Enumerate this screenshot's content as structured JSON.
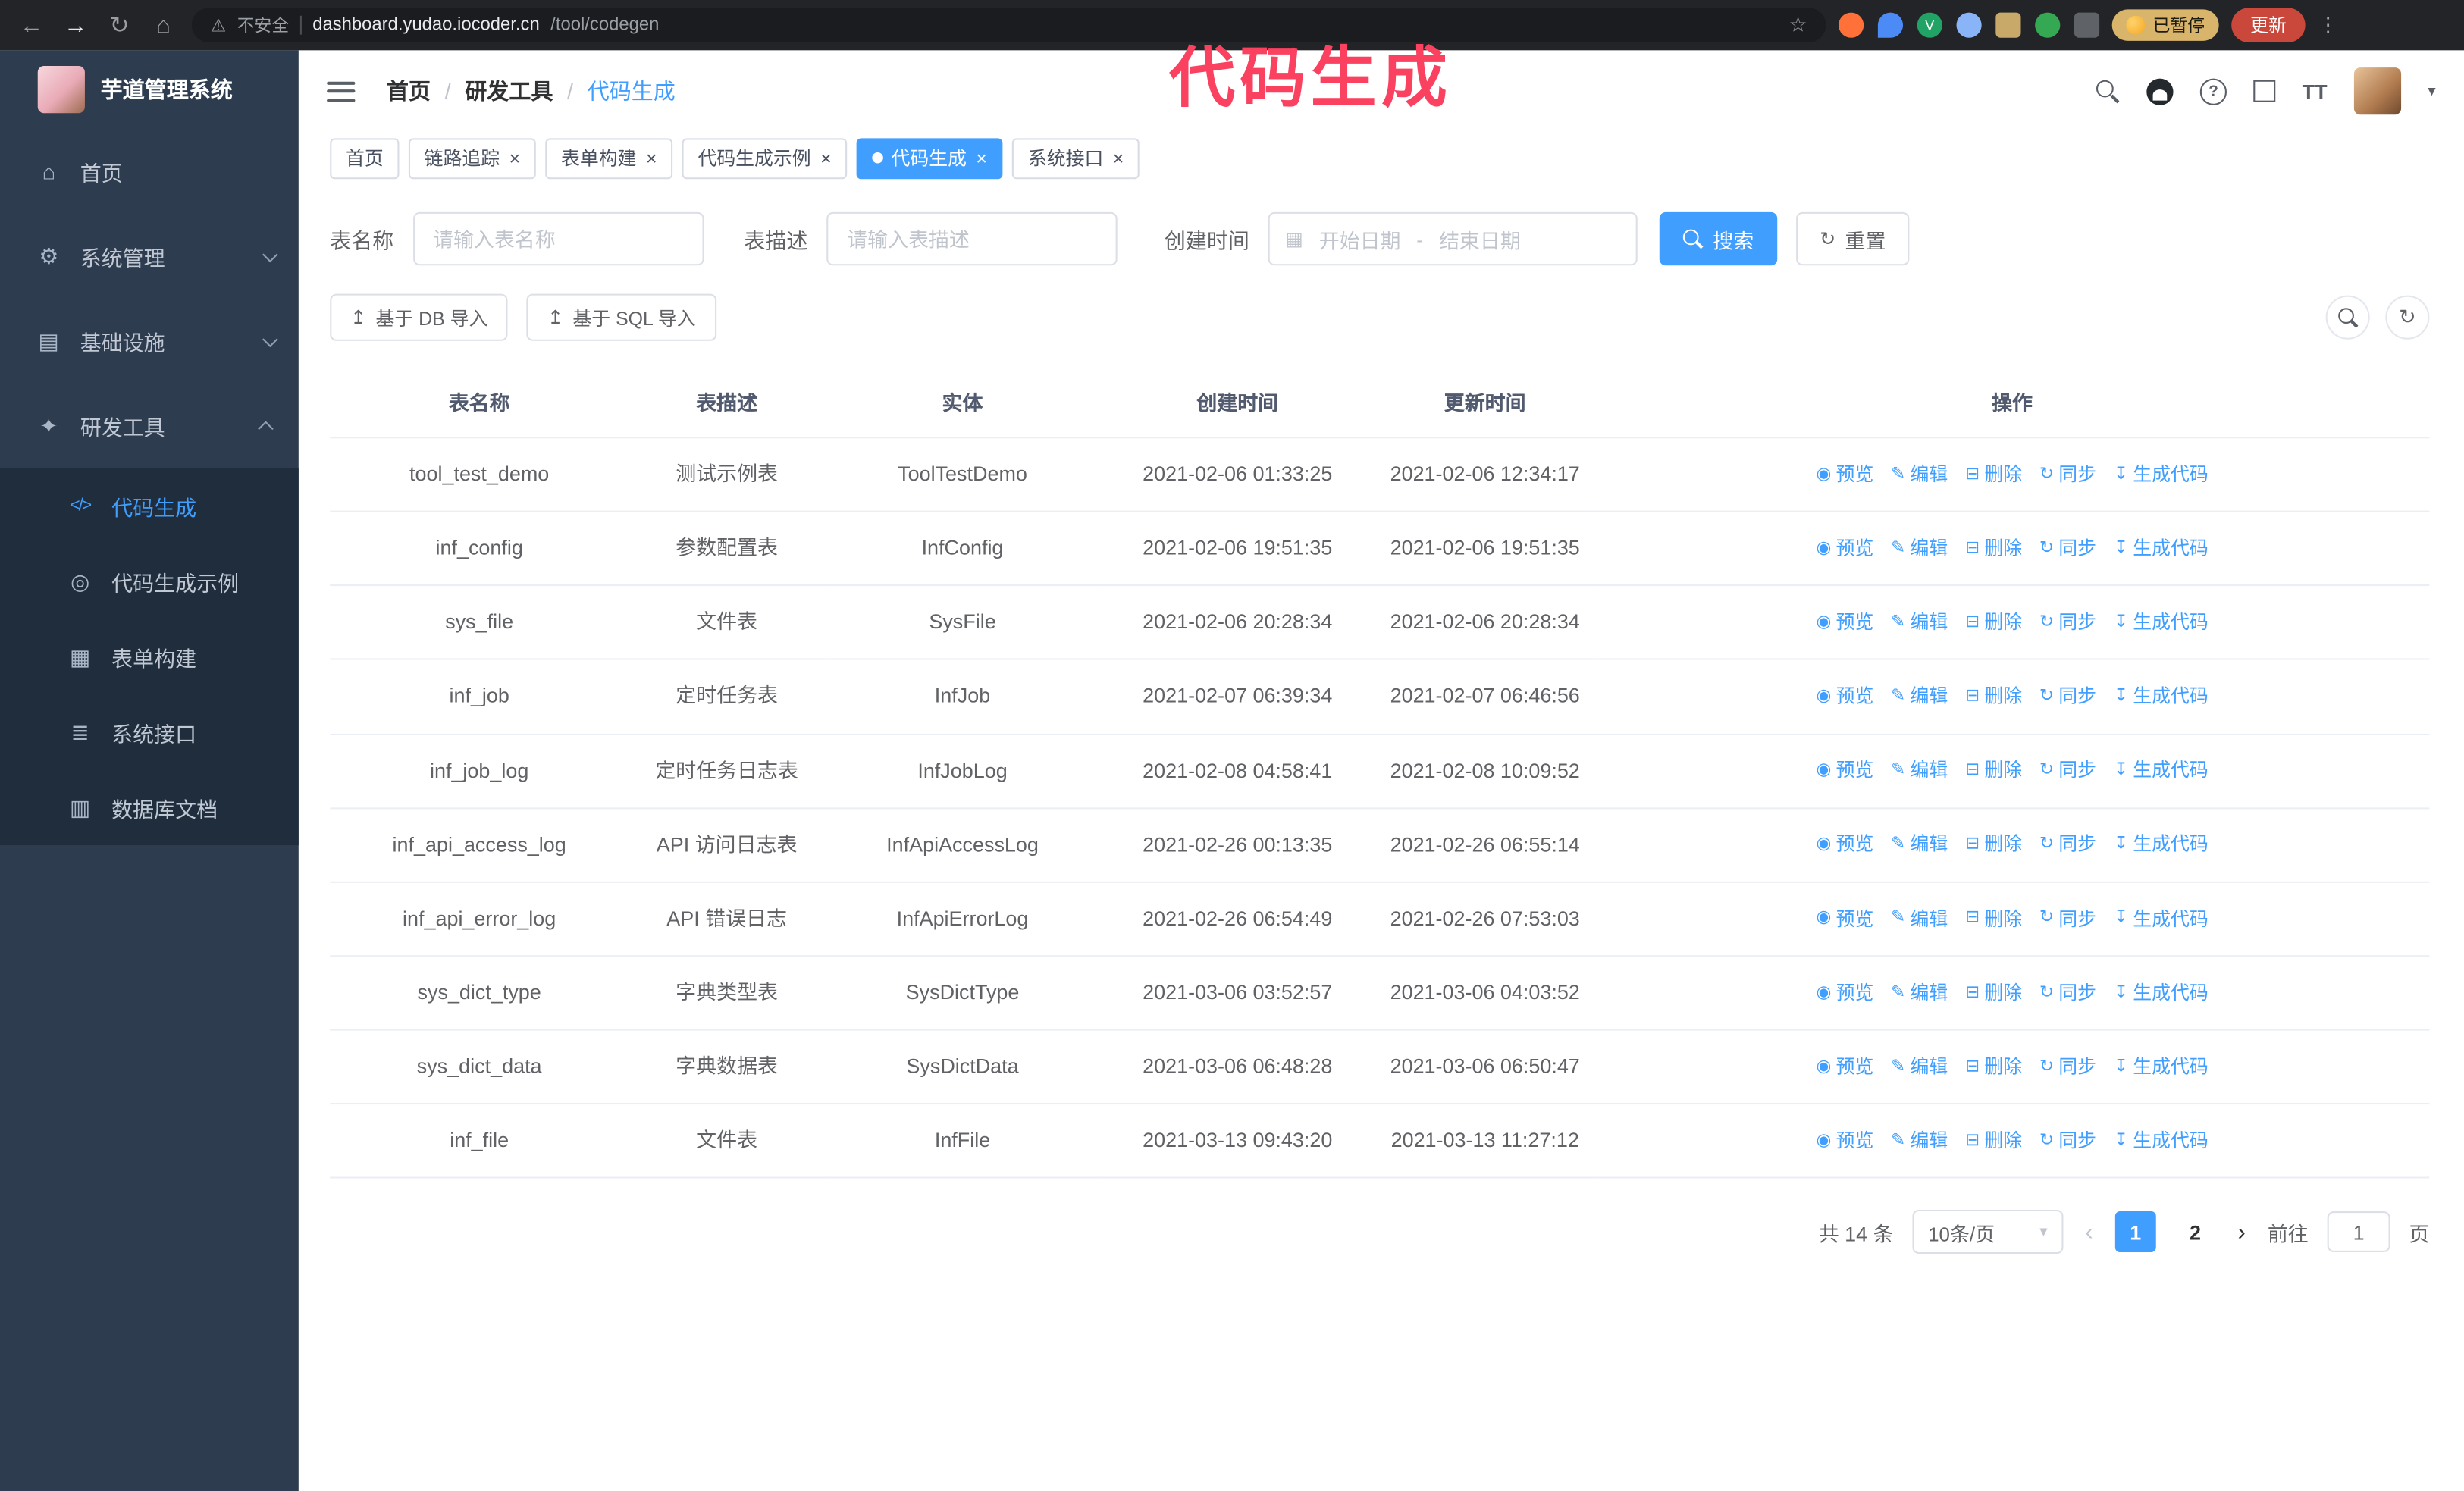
{
  "colors": {
    "accent": "#409eff",
    "sidebar_bg": "#2e3c4f",
    "submenu_bg": "#1f2d3c",
    "annotation": "#fb4160"
  },
  "browser": {
    "security_text": "不安全",
    "url_host": "dashboard.yudao.iocoder.cn",
    "url_path": "/tool/codegen",
    "paused_badge": "已暂停",
    "update_button": "更新"
  },
  "annotation": {
    "text": "代码生成"
  },
  "icons": {
    "back": "←",
    "forward": "→",
    "reload": "↻",
    "home": "⌂",
    "warning": "⚠",
    "star": "☆",
    "kebab": "⋮",
    "ext_v_letter": "V",
    "question": "?",
    "text_size": "TT",
    "caret_down": "▾",
    "calendar": "▦",
    "reset": "↻",
    "refresh": "↻",
    "upload": "↥",
    "preview": "◉",
    "edit": "✎",
    "delete": "⊟",
    "sync": "↻",
    "generate": "↧",
    "close": "×",
    "prev": "‹",
    "next": "›",
    "menu_home": "⌂",
    "menu_system": "⚙",
    "menu_infra": "▤",
    "menu_tools": "✦",
    "menu_codegen": "</>",
    "menu_example": "◎",
    "menu_form": "▦",
    "menu_api": "≣",
    "menu_db": "▥"
  },
  "sidebar": {
    "logo_title": "芋道管理系统",
    "items": [
      {
        "label": "首页"
      },
      {
        "label": "系统管理"
      },
      {
        "label": "基础设施"
      },
      {
        "label": "研发工具"
      }
    ],
    "submenu": [
      {
        "label": "代码生成"
      },
      {
        "label": "代码生成示例"
      },
      {
        "label": "表单构建"
      },
      {
        "label": "系统接口"
      },
      {
        "label": "数据库文档"
      }
    ]
  },
  "breadcrumb": {
    "items": [
      "首页",
      "研发工具",
      "代码生成"
    ],
    "separator": "/"
  },
  "tabs": [
    {
      "label": "首页"
    },
    {
      "label": "链路追踪"
    },
    {
      "label": "表单构建"
    },
    {
      "label": "代码生成示例"
    },
    {
      "label": "代码生成"
    },
    {
      "label": "系统接口"
    }
  ],
  "filters": {
    "table_name_label": "表名称",
    "table_name_placeholder": "请输入表名称",
    "table_desc_label": "表描述",
    "table_desc_placeholder": "请输入表描述",
    "create_time_label": "创建时间",
    "start_placeholder": "开始日期",
    "range_separator": "-",
    "end_placeholder": "结束日期",
    "search_label": "搜索",
    "reset_label": "重置"
  },
  "toolbar": {
    "import_db": "基于 DB 导入",
    "import_sql": "基于 SQL 导入"
  },
  "table": {
    "columns": [
      "表名称",
      "表描述",
      "实体",
      "创建时间",
      "更新时间",
      "操作"
    ],
    "actions": [
      "预览",
      "编辑",
      "删除",
      "同步",
      "生成代码"
    ],
    "rows": [
      {
        "name": "tool_test_demo",
        "desc": "测试示例表",
        "entity": "ToolTestDemo",
        "created": "2021-02-06 01:33:25",
        "updated": "2021-02-06 12:34:17"
      },
      {
        "name": "inf_config",
        "desc": "参数配置表",
        "entity": "InfConfig",
        "created": "2021-02-06 19:51:35",
        "updated": "2021-02-06 19:51:35"
      },
      {
        "name": "sys_file",
        "desc": "文件表",
        "entity": "SysFile",
        "created": "2021-02-06 20:28:34",
        "updated": "2021-02-06 20:28:34"
      },
      {
        "name": "inf_job",
        "desc": "定时任务表",
        "entity": "InfJob",
        "created": "2021-02-07 06:39:34",
        "updated": "2021-02-07 06:46:56"
      },
      {
        "name": "inf_job_log",
        "desc": "定时任务日志表",
        "entity": "InfJobLog",
        "created": "2021-02-08 04:58:41",
        "updated": "2021-02-08 10:09:52"
      },
      {
        "name": "inf_api_access_log",
        "desc": "API 访问日志表",
        "entity": "InfApiAccessLog",
        "created": "2021-02-26 00:13:35",
        "updated": "2021-02-26 06:55:14"
      },
      {
        "name": "inf_api_error_log",
        "desc": "API 错误日志",
        "entity": "InfApiErrorLog",
        "created": "2021-02-26 06:54:49",
        "updated": "2021-02-26 07:53:03"
      },
      {
        "name": "sys_dict_type",
        "desc": "字典类型表",
        "entity": "SysDictType",
        "created": "2021-03-06 03:52:57",
        "updated": "2021-03-06 04:03:52"
      },
      {
        "name": "sys_dict_data",
        "desc": "字典数据表",
        "entity": "SysDictData",
        "created": "2021-03-06 06:48:28",
        "updated": "2021-03-06 06:50:47"
      },
      {
        "name": "inf_file",
        "desc": "文件表",
        "entity": "InfFile",
        "created": "2021-03-13 09:43:20",
        "updated": "2021-03-13 11:27:12"
      }
    ]
  },
  "pagination": {
    "total": "共 14 条",
    "page_size": "10条/页",
    "page_1": "1",
    "page_2": "2",
    "goto_label": "前往",
    "goto_value": "1",
    "goto_suffix": "页"
  }
}
